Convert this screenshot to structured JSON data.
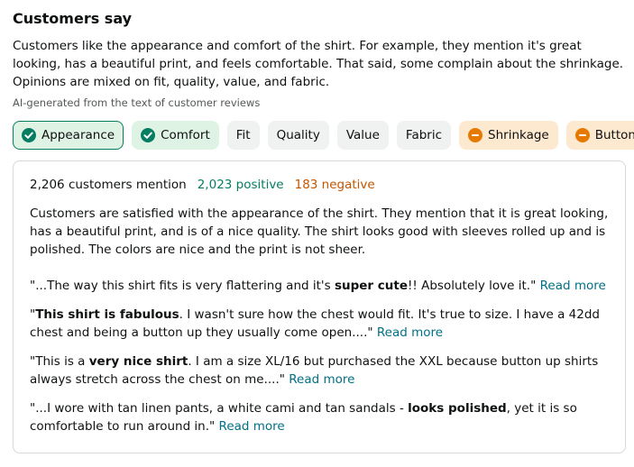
{
  "section": {
    "title": "Customers say",
    "summary": "Customers like the appearance and comfort of the shirt. For example, they mention it's great looking, has a beautiful print, and feels comfortable. That said, some complain about the shrinkage. Opinions are mixed on fit, quality, value, and fabric.",
    "ai_note": "AI-generated from the text of customer reviews"
  },
  "chips": [
    {
      "label": "Appearance",
      "sentiment": "positive",
      "selected": true
    },
    {
      "label": "Comfort",
      "sentiment": "positive",
      "selected": false
    },
    {
      "label": "Fit",
      "sentiment": "mixed",
      "selected": false
    },
    {
      "label": "Quality",
      "sentiment": "mixed",
      "selected": false
    },
    {
      "label": "Value",
      "sentiment": "mixed",
      "selected": false
    },
    {
      "label": "Fabric",
      "sentiment": "mixed",
      "selected": false
    },
    {
      "label": "Shrinkage",
      "sentiment": "negative",
      "selected": false
    },
    {
      "label": "Buttons",
      "sentiment": "negative",
      "selected": false
    }
  ],
  "panel": {
    "mention_count": "2,206 customers mention",
    "positive_count": "2,023 positive",
    "negative_count": "183 negative",
    "detail": "Customers are satisfied with the appearance of the shirt. They mention that it is great looking, has a beautiful print, and is of a nice quality. The shirt looks good with sleeves rolled up and is polished. The colors are nice and the print is not sheer.",
    "quotes": [
      {
        "before": "\"...The way this shirt fits is very flattering and it's ",
        "bold": "super cute",
        "after": "!! Absolutely love it.\" "
      },
      {
        "before": "\"",
        "bold": "This shirt is fabulous",
        "after": ". I wasn't sure how the chest would fit. It's true to size. I have a 42dd chest and being a button up they usually come open....\" "
      },
      {
        "before": "\"This is a ",
        "bold": "very nice shirt",
        "after": ". I am a size XL/16 but purchased the XXL because button up shirts always stretch across the chest on me....\" "
      },
      {
        "before": "\"...I wore with tan linen pants, a white cami and tan sandals - ",
        "bold": "looks polished",
        "after": ", yet it is so comfortable to run around in.\" "
      }
    ],
    "read_more": "Read more"
  },
  "colors": {
    "positive_icon": "#067d62",
    "negative_icon": "#e67a00",
    "link": "#007185"
  },
  "icons": {
    "positive": "check-circle-icon",
    "negative": "minus-circle-icon"
  }
}
